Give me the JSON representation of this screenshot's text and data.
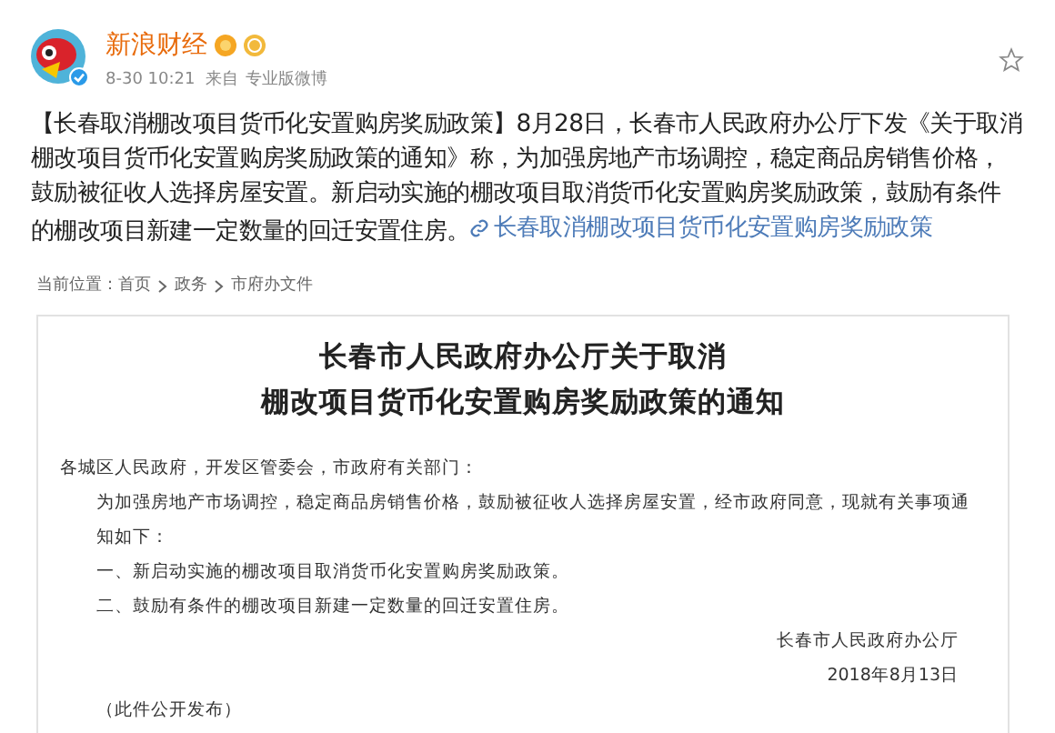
{
  "post": {
    "author": "新浪财经",
    "time": "8-30 10:21",
    "source_prefix": "来自",
    "source": "专业版微博",
    "verified": true,
    "text": "【长春取消棚改项目货币化安置购房奖励政策】8月28日，长春市人民政府办公厅下发《关于取消棚改项目货币化安置购房奖励政策的通知》称，为加强房地产市场调控，稳定商品房销售价格，鼓励被征收人选择房屋安置。新启动实施的棚改项目取消货币化安置购房奖励政策，鼓励有条件的棚改项目新建一定数量的回迁安置住房。",
    "link": "长春取消棚改项目货币化安置购房奖励政策"
  },
  "document": {
    "breadcrumb": [
      "当前位置：首页",
      "政务",
      "市府办文件"
    ],
    "title_lines": [
      "长春市人民政府办公厅关于取消",
      "棚改项目货币化安置购房奖励政策的通知"
    ],
    "salutation": "各城区人民政府，开发区管委会，市政府有关部门：",
    "paragraphs": [
      "为加强房地产市场调控，稳定商品房销售价格，鼓励被征收人选择房屋安置，经市政府同意，现就有关事项通知如下：",
      "一、新启动实施的棚改项目取消货币化安置购房奖励政策。",
      "二、鼓励有条件的棚改项目新建一定数量的回迁安置住房。"
    ],
    "signature": "长春市人民政府办公厅",
    "date": "2018年8月13日",
    "note": "（此件公开发布）"
  }
}
